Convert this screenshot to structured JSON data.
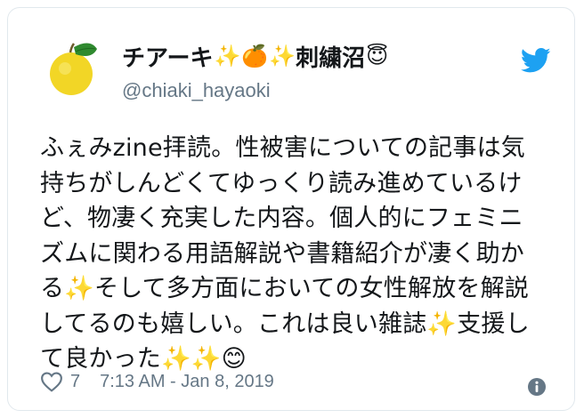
{
  "tweet": {
    "author": {
      "display_name": "チアーキ",
      "name_emojis": [
        "✨",
        "🍊",
        "✨"
      ],
      "name_suffix": "刺繍沼",
      "trailing_emoji": "😇",
      "handle": "@chiaki_hayaoki",
      "avatar_icon": "yuzu-fruit-avatar"
    },
    "text_lines": [
      "ふぇみzine拝読。性被害についての記事は気",
      "持ちがしんどくてゆっくり読み進めているけ",
      "ど、物凄く充実した内容。個人的にフェミニ",
      "ズムに関わる用語解説や書籍紹介が凄く助か",
      "る✨そして多方面においての女性解放を解説",
      "してるのも嬉しい。これは良い雑誌✨支援し",
      "て良かった✨✨😊"
    ],
    "likes": "7",
    "timestamp": "7:13 AM - Jan 8, 2019",
    "icons": {
      "logo": "twitter-bird-icon",
      "like": "heart-icon",
      "info": "info-icon"
    },
    "colors": {
      "brand": "#1da1f2",
      "text": "#14171a",
      "secondary": "#657786",
      "border": "#e1e8ed"
    }
  }
}
